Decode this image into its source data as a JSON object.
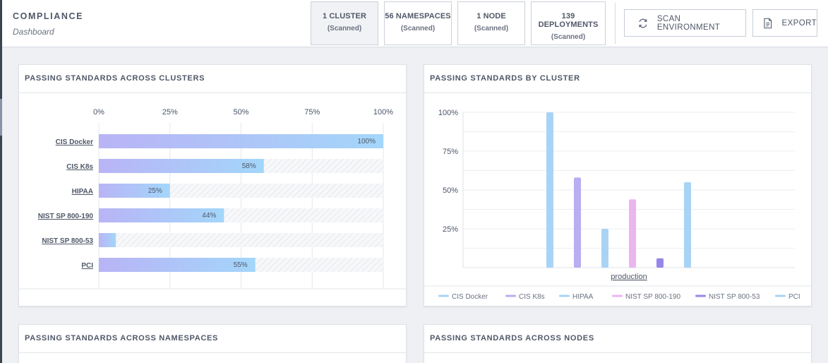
{
  "header": {
    "title": "COMPLIANCE",
    "subtitle": "Dashboard",
    "tiles": [
      {
        "label": "1 CLUSTER",
        "sub": "(Scanned)"
      },
      {
        "label": "56 NAMESPACES",
        "sub": "(Scanned)"
      },
      {
        "label": "1 NODE",
        "sub": "(Scanned)"
      },
      {
        "label": "139 DEPLOYMENTS",
        "sub": "(Scanned)"
      }
    ],
    "scan_label": "SCAN ENVIRONMENT",
    "export_label": "EXPORT"
  },
  "cards": {
    "clusters_title": "PASSING STANDARDS ACROSS CLUSTERS",
    "by_cluster_title": "PASSING STANDARDS BY CLUSTER",
    "namespaces_title": "PASSING STANDARDS ACROSS NAMESPACES",
    "nodes_title": "PASSING STANDARDS ACROSS NODES"
  },
  "colors": {
    "bar_start": "#b9b4f6",
    "bar_end": "#a3d6fa",
    "cis_docker": "#a9d3f5",
    "cis_k8s": "#b8aef2",
    "hipaa": "#a9d3f5",
    "nist_190": "#ebb5ef",
    "nist_53": "#9786ea",
    "pci": "#a9d3f5"
  },
  "chart_data": [
    {
      "type": "bar",
      "orientation": "horizontal",
      "categories": [
        "CIS Docker",
        "CIS K8s",
        "HIPAA",
        "NIST SP 800-190",
        "NIST SP 800-53",
        "PCI"
      ],
      "values": [
        100,
        58,
        25,
        44,
        6,
        55
      ],
      "value_labels": [
        "100%",
        "58%",
        "25%",
        "44%",
        "",
        "55%"
      ],
      "xticks": [
        "0%",
        "25%",
        "50%",
        "75%",
        "100%"
      ],
      "xlim": [
        0,
        100
      ],
      "grid": true
    },
    {
      "type": "bar",
      "categories": [
        "production"
      ],
      "series": [
        {
          "name": "CIS Docker",
          "values": [
            100
          ]
        },
        {
          "name": "CIS K8s",
          "values": [
            58
          ]
        },
        {
          "name": "HIPAA",
          "values": [
            25
          ]
        },
        {
          "name": "NIST SP 800-190",
          "values": [
            44
          ]
        },
        {
          "name": "NIST SP 800-53",
          "values": [
            6
          ]
        },
        {
          "name": "PCI",
          "values": [
            55
          ]
        }
      ],
      "yticks": [
        "100%",
        "75%",
        "50%",
        "25%"
      ],
      "ylim": [
        0,
        100
      ],
      "grid": true,
      "legend": "bottom"
    }
  ]
}
